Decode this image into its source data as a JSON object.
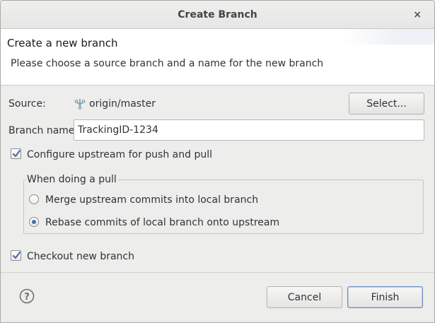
{
  "window": {
    "title": "Create Branch",
    "close_glyph": "×"
  },
  "banner": {
    "title": "Create a new branch",
    "description": "Please choose a source branch and a name for the new branch"
  },
  "source": {
    "label": "Source:",
    "icon": "branch-icon",
    "value": "origin/master",
    "select_button": "Select..."
  },
  "branch_name": {
    "label": "Branch name:",
    "value": "TrackingID-1234"
  },
  "configure_upstream": {
    "label": "Configure upstream for push and pull",
    "checked": true
  },
  "pull_group": {
    "legend": "When doing a pull",
    "options": [
      {
        "label": "Merge upstream commits into local branch",
        "selected": false
      },
      {
        "label": "Rebase commits of local branch onto upstream",
        "selected": true
      }
    ]
  },
  "checkout": {
    "label": "Checkout new branch",
    "checked": true
  },
  "footer": {
    "help_icon": "help-icon",
    "cancel_label": "Cancel",
    "finish_label": "Finish"
  },
  "colors": {
    "accent": "#4a6ea8",
    "window_bg": "#ededec",
    "banner_bg": "#ffffff"
  }
}
